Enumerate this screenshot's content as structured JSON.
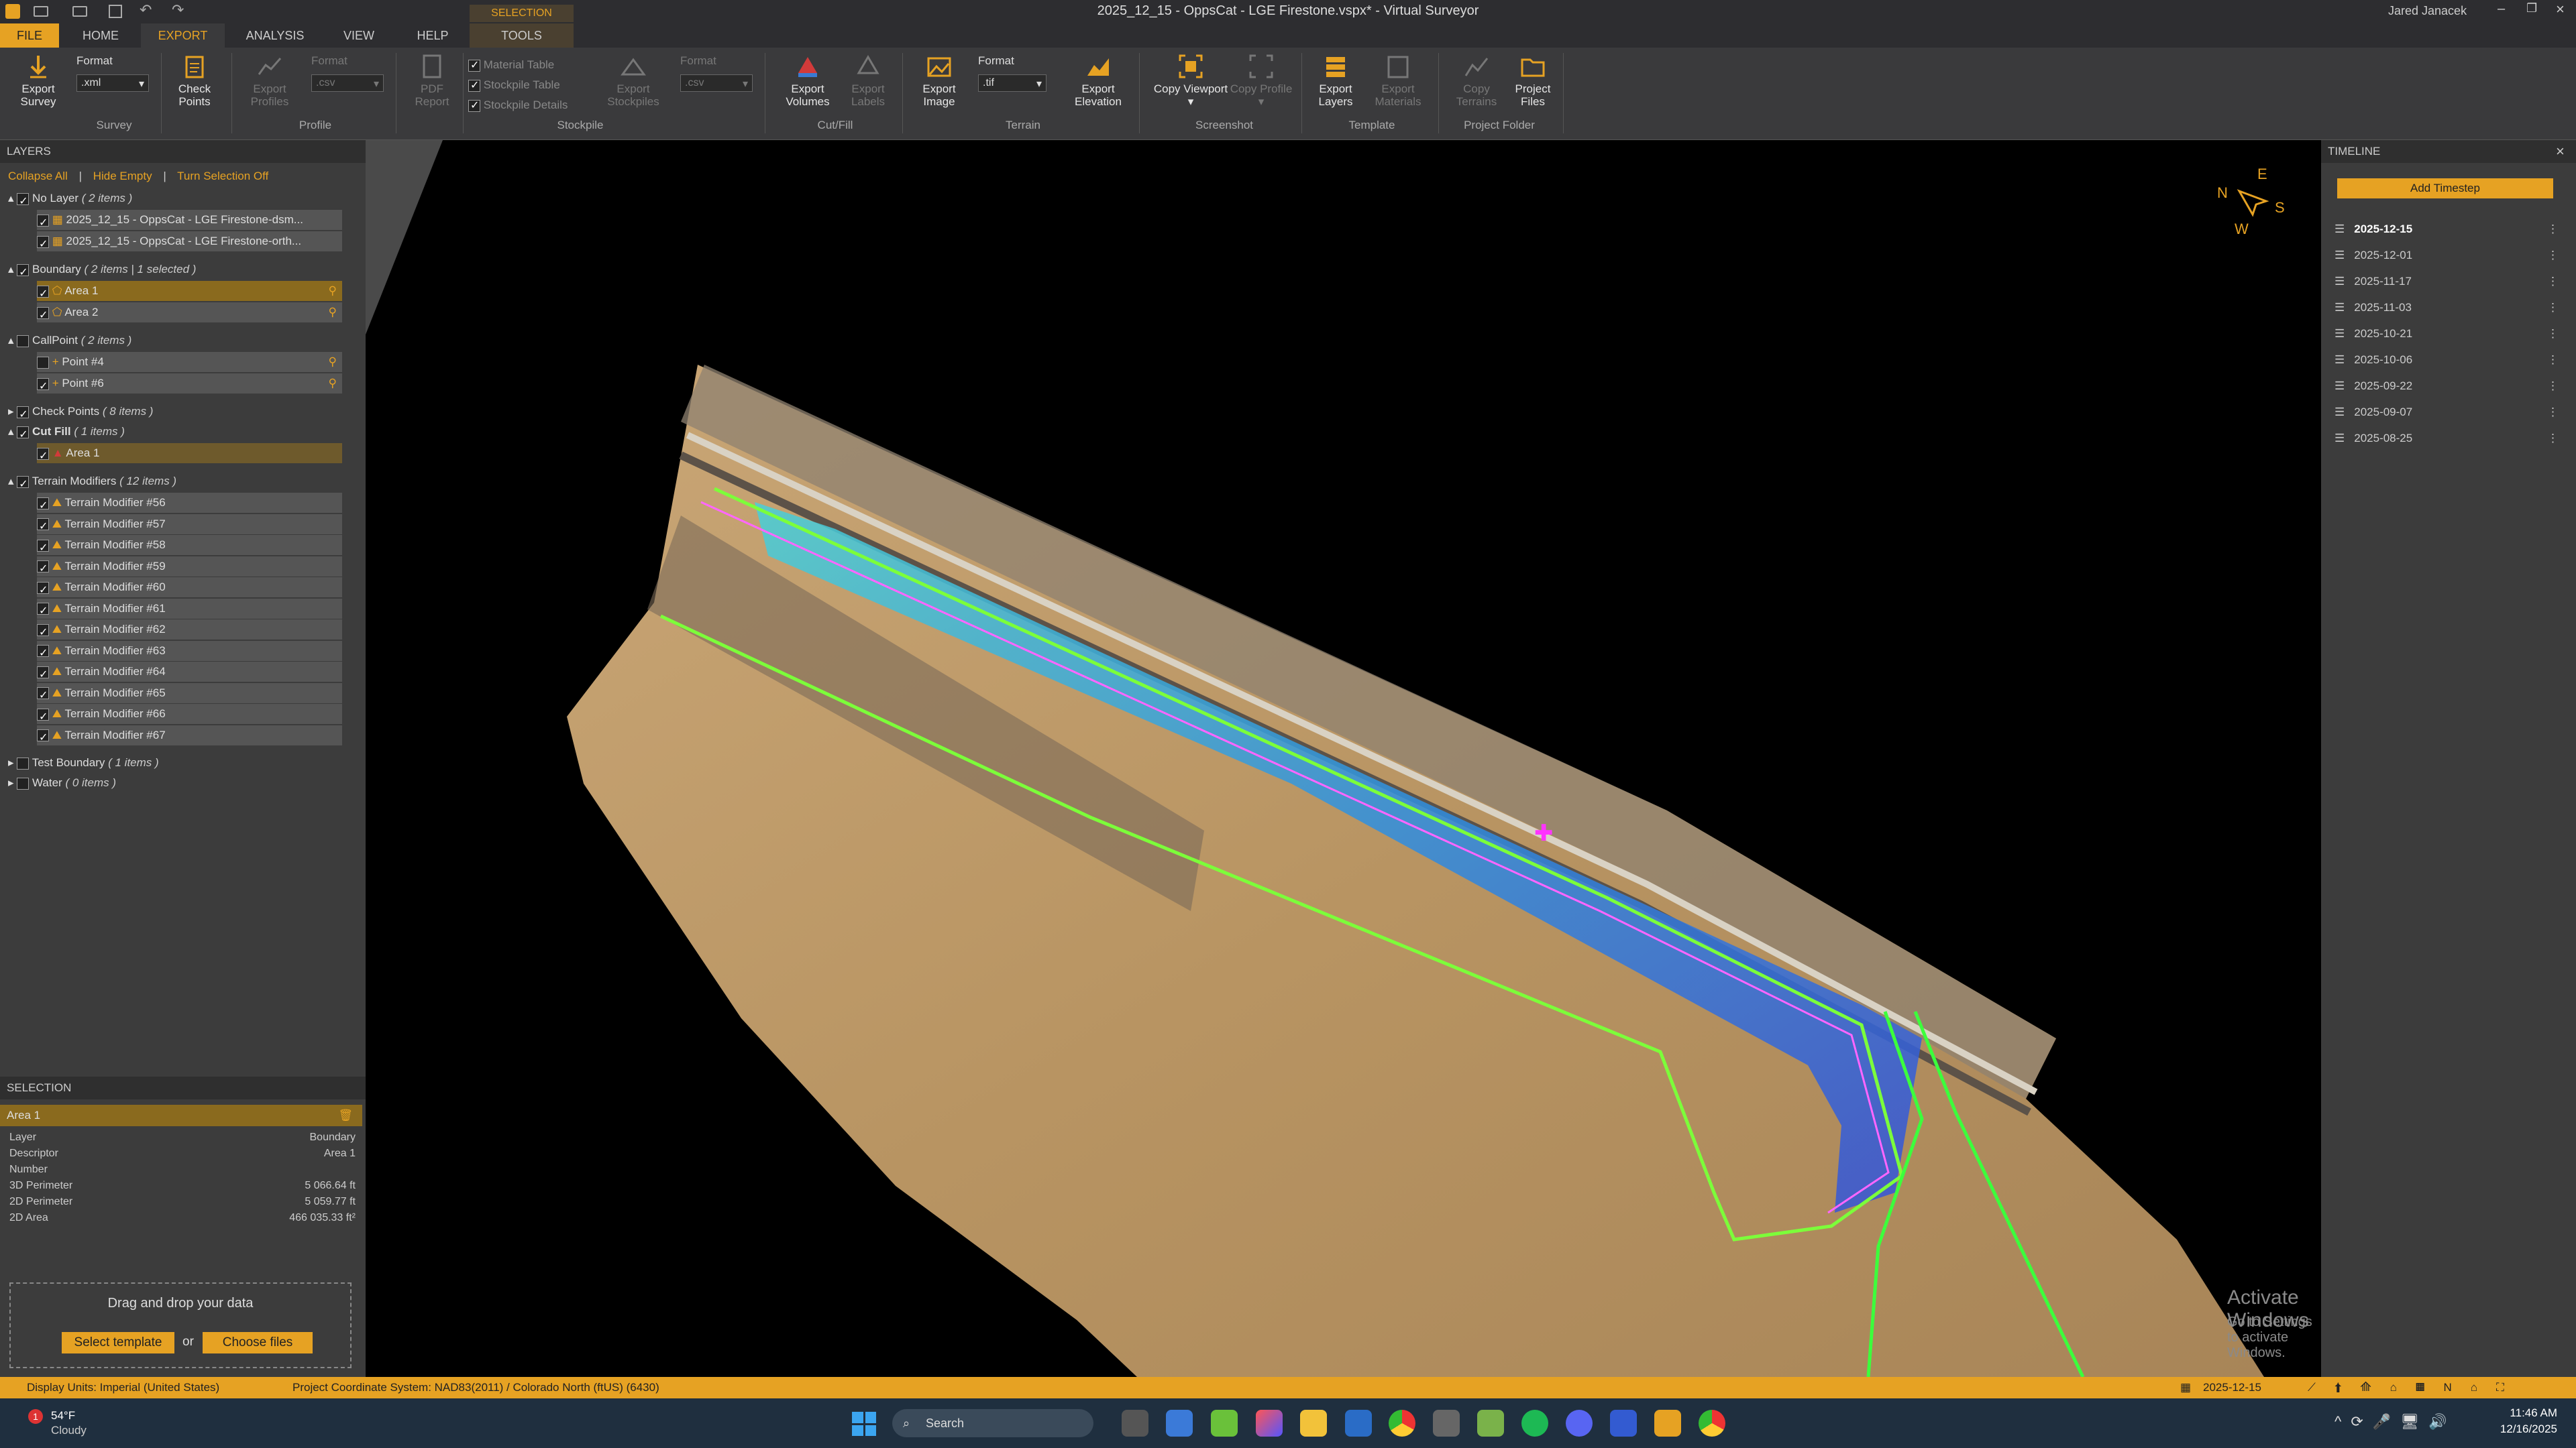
{
  "app": {
    "title": "2025_12_15 - OppsCat - LGE Firestone.vspx* - Virtual Surveyor",
    "user": "Jared Janacek",
    "context_tab_group": "SELECTION"
  },
  "tabs": [
    "FILE",
    "HOME",
    "EXPORT",
    "ANALYSIS",
    "VIEW",
    "HELP",
    "TOOLS"
  ],
  "ribbon": {
    "survey": {
      "export_survey": "Export Survey",
      "format_label": "Format",
      "format_value": ".xml",
      "group": "Survey"
    },
    "check_points": "Check Points",
    "profile": {
      "export_profiles": "Export Profiles",
      "format_label": "Format",
      "format_value": ".csv",
      "group": "Profile"
    },
    "pdf_report": "PDF Report",
    "stockpile": {
      "material_table": "Material Table",
      "stockpile_table": "Stockpile Table",
      "stockpile_details": "Stockpile Details",
      "export_stockpiles": "Export Stockpiles",
      "format_label": "Format",
      "format_value": ".csv",
      "group": "Stockpile"
    },
    "cutfill": {
      "export_volumes": "Export Volumes",
      "export_labels": "Export Labels",
      "group": "Cut/Fill"
    },
    "terrain": {
      "export_image": "Export Image",
      "format_label": "Format",
      "format_value": ".tif",
      "export_elevation": "Export Elevation",
      "group": "Terrain"
    },
    "screenshot": {
      "copy_viewport": "Copy Viewport ▾",
      "copy_profile": "Copy Profile ▾",
      "group": "Screenshot"
    },
    "template": {
      "export_layers": "Export Layers",
      "export_materials": "Export Materials",
      "group": "Template"
    },
    "project_folder": {
      "copy_terrains": "Copy Terrains",
      "project_files": "Project Files",
      "group": "Project Folder"
    }
  },
  "layers": {
    "header": "LAYERS",
    "actions": [
      "Collapse All",
      "Hide Empty",
      "Turn Selection Off"
    ],
    "groups": [
      {
        "name": "No Layer",
        "count": "( 2 items )"
      },
      {
        "name": "Boundary",
        "count": "( 2 items | 1 selected )"
      },
      {
        "name": "CallPoint",
        "count": "( 2 items )"
      },
      {
        "name": "Check Points",
        "count": "( 8 items )"
      },
      {
        "name": "Cut Fill",
        "count": "( 1 items )"
      },
      {
        "name": "Terrain Modifiers",
        "count": "( 12 items )"
      },
      {
        "name": "Test Boundary",
        "count": "( 1 items )"
      },
      {
        "name": "Water",
        "count": "( 0 items )"
      }
    ],
    "nolayer_items": [
      "2025_12_15 - OppsCat - LGE Firestone-dsm...",
      "2025_12_15 - OppsCat - LGE Firestone-orth..."
    ],
    "boundary_items": [
      "Area 1",
      "Area 2"
    ],
    "callpoint_items": [
      "Point #4",
      "Point #6"
    ],
    "cutfill_items": [
      "Area 1"
    ],
    "terrain_items": [
      "Terrain Modifier #56",
      "Terrain Modifier #57",
      "Terrain Modifier #58",
      "Terrain Modifier #59",
      "Terrain Modifier #60",
      "Terrain Modifier #61",
      "Terrain Modifier #62",
      "Terrain Modifier #63",
      "Terrain Modifier #64",
      "Terrain Modifier #65",
      "Terrain Modifier #66",
      "Terrain Modifier #67"
    ]
  },
  "selection": {
    "header": "SELECTION",
    "name": "Area 1",
    "props": [
      {
        "k": "Layer",
        "v": "Boundary"
      },
      {
        "k": "Descriptor",
        "v": "Area 1"
      },
      {
        "k": "Number",
        "v": ""
      },
      {
        "k": "3D Perimeter",
        "v": "5 066.64 ft"
      },
      {
        "k": "2D Perimeter",
        "v": "5 059.77 ft"
      },
      {
        "k": "2D Area",
        "v": "466 035.33 ft²"
      }
    ]
  },
  "dropzone": {
    "text": "Drag and drop your data",
    "select_template": "Select template",
    "or": "or",
    "choose_files": "Choose files"
  },
  "timeline": {
    "header": "TIMELINE",
    "add": "Add Timestep",
    "dates": [
      "2025-12-15",
      "2025-12-01",
      "2025-11-17",
      "2025-11-03",
      "2025-10-21",
      "2025-10-06",
      "2025-09-22",
      "2025-09-07",
      "2025-08-25"
    ]
  },
  "compass": {
    "n": "N",
    "e": "E",
    "s": "S",
    "w": "W"
  },
  "watermark": {
    "line1": "Activate Windows",
    "line2": "Go to Settings to activate Windows."
  },
  "status": {
    "units": "Display Units:  Imperial (United States)",
    "crs": "Project Coordinate System:  NAD83(2011) / Colorado North (ftUS) (6430)",
    "date": "2025-12-15"
  },
  "taskbar": {
    "temp": "54°F",
    "weather": "Cloudy",
    "search": "Search",
    "time": "11:46 AM",
    "date": "12/16/2025",
    "badge": "1"
  },
  "colors": {
    "accent": "#e6a223",
    "boundary": "#7cff3a",
    "cut": "#3fbfd0"
  }
}
